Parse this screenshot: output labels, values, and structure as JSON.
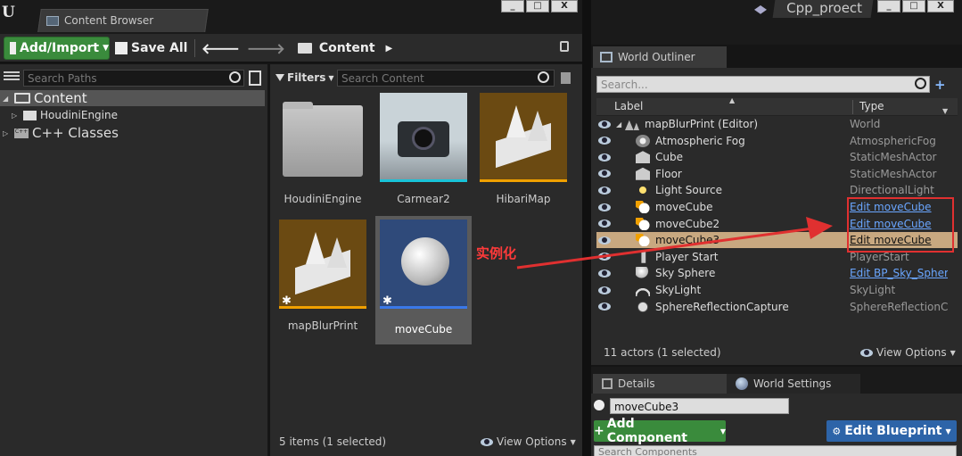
{
  "content_browser": {
    "tab_title": "Content Browser",
    "add_import_label": "Add/Import",
    "save_all_label": "Save All",
    "current_path": "Content",
    "search_paths_placeholder": "Search Paths",
    "filters_label": "Filters",
    "search_content_placeholder": "Search Content",
    "tree": [
      {
        "label": "Content",
        "selected": true
      },
      {
        "label": "HoudiniEngine",
        "selected": false
      },
      {
        "label": "C++ Classes",
        "selected": false
      }
    ],
    "assets": [
      {
        "label": "HoudiniEngine",
        "kind": "folder"
      },
      {
        "label": "Carmear2",
        "kind": "static-mesh",
        "accent": "#19c3d8"
      },
      {
        "label": "HibariMap",
        "kind": "map",
        "accent": "#f0a000"
      },
      {
        "label": "mapBlurPrint",
        "kind": "map",
        "accent": "#f0a000"
      },
      {
        "label": "moveCube",
        "kind": "blueprint",
        "accent": "#3a78e8",
        "selected": true
      }
    ],
    "status": "5 items (1 selected)",
    "view_options_label": "View Options"
  },
  "window": {
    "project_name": "Cpp_proect",
    "minimize": "_",
    "maximize": "□",
    "close": "X"
  },
  "world_outliner": {
    "tab_title": "World Outliner",
    "search_placeholder": "Search...",
    "col_label": "Label",
    "col_type": "Type",
    "rows": [
      {
        "label": "mapBlurPrint (Editor)",
        "type": "World",
        "link": false,
        "icon": "world-icon"
      },
      {
        "label": "Atmospheric Fog",
        "type": "AtmosphericFog",
        "link": false,
        "icon": "fog-icon"
      },
      {
        "label": "Cube",
        "type": "StaticMeshActor",
        "link": false,
        "icon": "mesh-icon"
      },
      {
        "label": "Floor",
        "type": "StaticMeshActor",
        "link": false,
        "icon": "mesh-icon"
      },
      {
        "label": "Light Source",
        "type": "DirectionalLight",
        "link": false,
        "icon": "sun-icon"
      },
      {
        "label": "moveCube",
        "type": "Edit moveCube",
        "link": true,
        "icon": "blueprint-actor-icon"
      },
      {
        "label": "moveCube2",
        "type": "Edit moveCube",
        "link": true,
        "icon": "blueprint-actor-icon"
      },
      {
        "label": "moveCube3",
        "type": "Edit moveCube",
        "link": true,
        "icon": "blueprint-actor-icon",
        "selected": true
      },
      {
        "label": "Player Start",
        "type": "PlayerStart",
        "link": false,
        "icon": "player-start-icon"
      },
      {
        "label": "Sky Sphere",
        "type": "Edit BP_Sky_Spher",
        "link": true,
        "icon": "sphere-icon"
      },
      {
        "label": "SkyLight",
        "type": "SkyLight",
        "link": false,
        "icon": "skylight-icon"
      },
      {
        "label": "SphereReflectionCapture",
        "type": "SphereReflectionCap",
        "link": false,
        "icon": "reflection-icon"
      }
    ],
    "status": "11 actors (1 selected)",
    "view_options_label": "View Options"
  },
  "details": {
    "tab_title": "Details",
    "world_settings_tab": "World Settings",
    "selected_name": "moveCube3",
    "add_component_label": "Add Component",
    "edit_blueprint_label": "Edit Blueprint",
    "search_components_placeholder": "Search Components"
  },
  "annotation": {
    "text": "实例化",
    "color": "#e03030"
  }
}
